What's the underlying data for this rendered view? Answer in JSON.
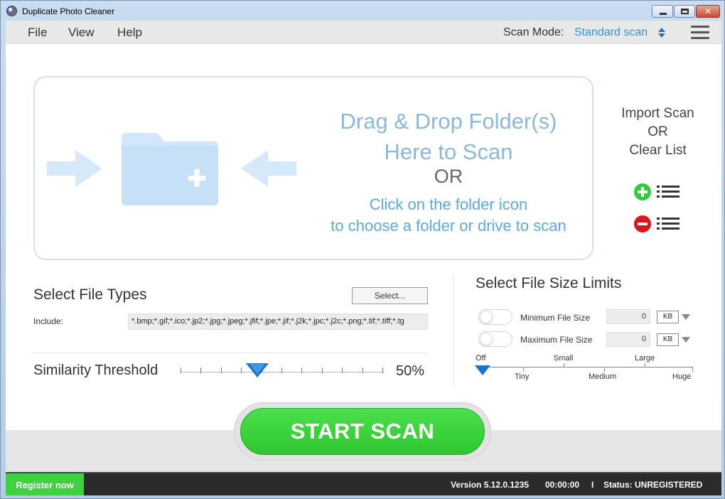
{
  "window": {
    "title": "Duplicate Photo Cleaner"
  },
  "menu": {
    "file": "File",
    "view": "View",
    "help": "Help"
  },
  "scan_mode": {
    "label": "Scan Mode:",
    "value": "Standard scan"
  },
  "dropzone": {
    "line1": "Drag & Drop Folder(s)",
    "line2": "Here to Scan",
    "or": "OR",
    "hint1": "Click on the folder icon",
    "hint2": "to choose a folder or drive to scan"
  },
  "import_panel": {
    "line1": "Import Scan",
    "line2": "OR",
    "line3": "Clear List"
  },
  "file_types": {
    "title": "Select File Types",
    "select_label": "Select...",
    "include_label": "Include:",
    "include_value": "*.bmp;*.gif;*.ico;*.jp2;*.jpg;*.jpeg;*.jfif;*.jpe;*.jif;*.j2k;*.jpc;*.j2c;*.png;*.tif;*.tiff;*.tg"
  },
  "threshold": {
    "label": "Similarity Threshold",
    "value_text": "50%",
    "value": 50
  },
  "size_limits": {
    "title": "Select File Size Limits",
    "min_label": "Minimum File Size",
    "min_value": "0",
    "min_unit": "KB",
    "max_label": "Maximum File Size",
    "max_value": "0",
    "max_unit": "KB",
    "scale_top": [
      "Off",
      "Small",
      "Large"
    ],
    "scale_bottom": [
      "Tiny",
      "Medium",
      "Huge"
    ]
  },
  "actions": {
    "start_scan": "START SCAN"
  },
  "status": {
    "register": "Register now",
    "version": "Version 5.12.0.1235",
    "time": "00:00:00",
    "separator": "I",
    "status": "Status: UNREGISTERED"
  },
  "colors": {
    "accent_blue": "#2b94d6",
    "start_green": "#38d038",
    "drop_text": "#8cb8dc"
  }
}
